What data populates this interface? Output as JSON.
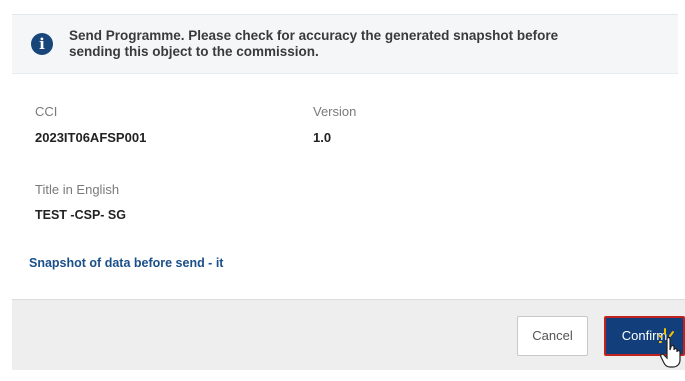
{
  "info": {
    "line1": "Send Programme. Please check for accuracy the generated snapshot before",
    "line2": "sending this object to the commission.",
    "icon": "info-icon"
  },
  "fields": {
    "cci_label": "CCI",
    "cci_value": "2023IT06AFSP001",
    "version_label": "Version",
    "version_value": "1.0",
    "title_label": "Title in English",
    "title_value": "TEST -CSP- SG"
  },
  "snapshot_link": "Snapshot of data before send - it",
  "buttons": {
    "cancel": "Cancel",
    "confirm": "Confirm"
  },
  "colors": {
    "primary": "#123f7c",
    "highlight_border": "#c0221f",
    "link": "#1a4f8a"
  }
}
